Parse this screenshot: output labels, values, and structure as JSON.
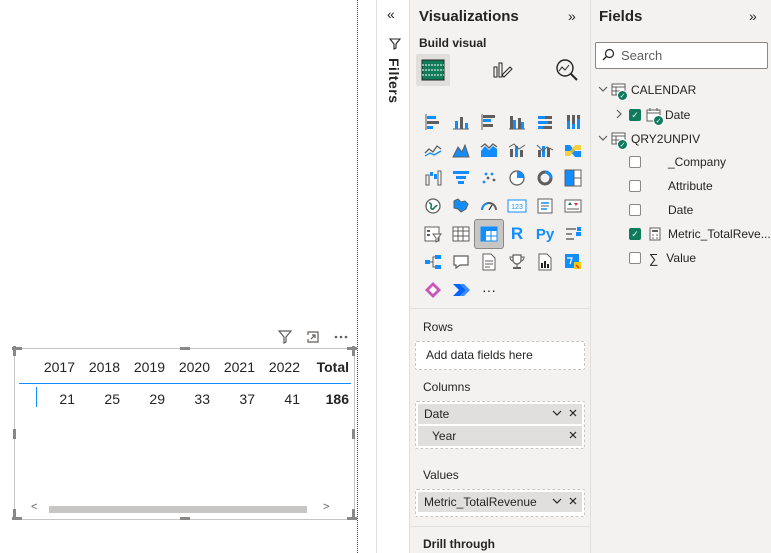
{
  "matrix": {
    "columns": [
      "2017",
      "2018",
      "2019",
      "2020",
      "2021",
      "2022"
    ],
    "total_label": "Total",
    "values": [
      "21",
      "25",
      "29",
      "33",
      "37",
      "41"
    ],
    "total_value": "186",
    "scroll_left": "<",
    "scroll_right": ">"
  },
  "filters": {
    "label": "Filters",
    "collapse_icon": "«"
  },
  "visualizations": {
    "title": "Visualizations",
    "expand_icon": "»",
    "build_visual_label": "Build visual",
    "wells": {
      "rows_label": "Rows",
      "rows_placeholder": "Add data fields here",
      "columns_label": "Columns",
      "columns_fields": [
        {
          "label": "Date"
        },
        {
          "label": "Year"
        }
      ],
      "values_label": "Values",
      "values_fields": [
        {
          "label": "Metric_TotalRevenue"
        }
      ],
      "drillthrough_label": "Drill through"
    },
    "more_label": "···",
    "r_label": "R",
    "py_label": "Py"
  },
  "fields": {
    "title": "Fields",
    "expand_icon": "»",
    "search_placeholder": "Search",
    "tables": [
      {
        "name": "CALENDAR",
        "items": [
          {
            "label": "Date",
            "checked": true
          }
        ]
      },
      {
        "name": "QRY2UNPIV",
        "items": [
          {
            "label": "_Company",
            "checked": false
          },
          {
            "label": "Attribute",
            "checked": false
          },
          {
            "label": "Date",
            "checked": false
          },
          {
            "label": "Metric_TotalReve...",
            "checked": true
          },
          {
            "label": "Value",
            "checked": false
          }
        ]
      }
    ]
  },
  "colors": {
    "accent_blue": "#118dff",
    "check_green": "#0f7b5c",
    "pane_bg": "#f3f2f1"
  }
}
